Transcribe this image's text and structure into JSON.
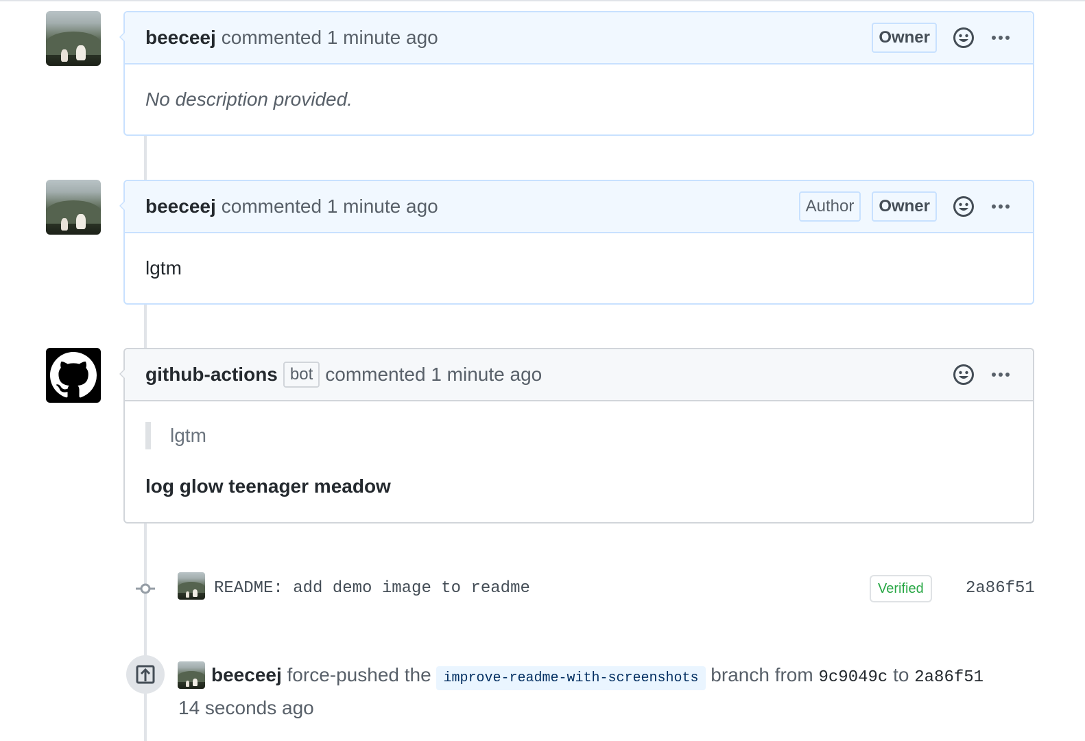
{
  "comments": [
    {
      "author": "beeceej",
      "meta": "commented 1 minute ago",
      "badges": [
        "Owner"
      ],
      "body": "No description provided."
    },
    {
      "author": "beeceej",
      "meta": "commented 1 minute ago",
      "badges": [
        "Author",
        "Owner"
      ],
      "body": "lgtm"
    },
    {
      "author": "github-actions",
      "bot_badge": "bot",
      "meta": "commented 1 minute ago",
      "quote": "lgtm",
      "body": "log glow teenager meadow"
    }
  ],
  "commit": {
    "message": "README: add demo image to readme",
    "verified": "Verified",
    "sha": "2a86f51"
  },
  "force_push": {
    "author": "beeceej",
    "text_before": "force-pushed the",
    "branch": "improve-readme-with-screenshots",
    "text_middle": "branch from",
    "from_sha": "9c9049c",
    "text_to": "to",
    "to_sha": "2a86f51",
    "time": "14 seconds ago"
  },
  "colors": {
    "accent_border": "#c8e1ff",
    "header_bg": "#f1f8ff",
    "verified_green": "#28a745"
  },
  "icons": [
    "smiley-icon",
    "kebab-icon",
    "commit-icon",
    "repo-push-icon",
    "github-mark-icon"
  ]
}
